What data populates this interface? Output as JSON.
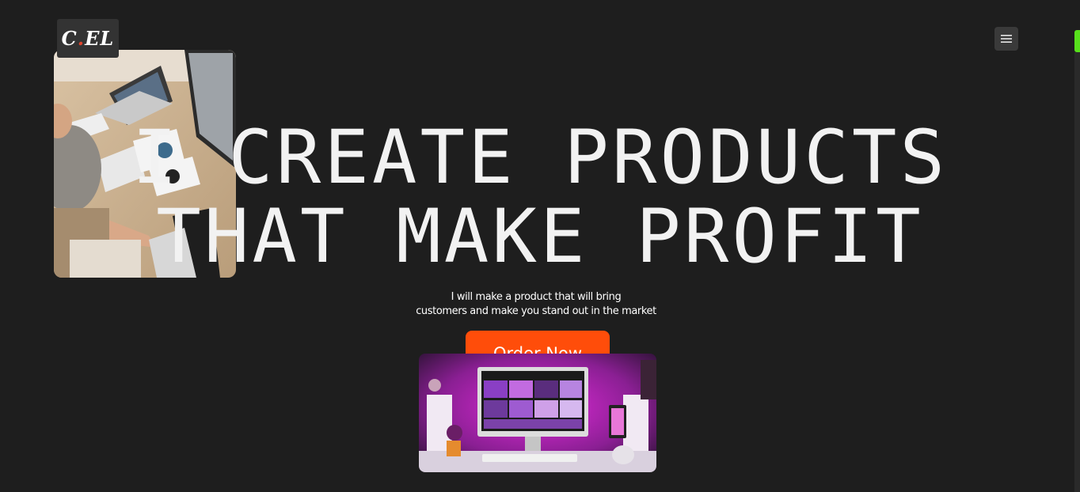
{
  "brand": {
    "logo_text_1": "C",
    "logo_dot": ".",
    "logo_text_2": "EL"
  },
  "header": {
    "menu_icon": "hamburger-icon"
  },
  "hero": {
    "headline_line1": "I CREATE PRODUCTS",
    "headline_line2": "THAT MAKE PROFIT",
    "subtitle_line1": "I will make a product that will bring",
    "subtitle_line2": "customers and make you stand out in the market",
    "cta_label": "Order Now"
  },
  "colors": {
    "background": "#1e1e1e",
    "accent": "#ff4d0a",
    "scroll_indicator": "#57e01c"
  }
}
